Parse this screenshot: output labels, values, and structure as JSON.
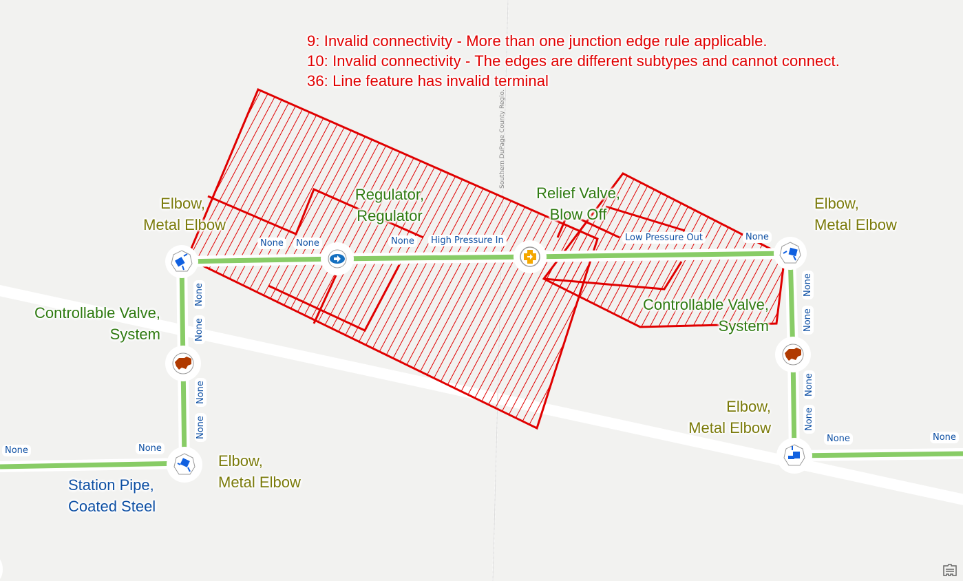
{
  "errors": [
    "9: Invalid connectivity - More than one junction edge rule applicable.",
    "10: Invalid connectivity - The edges are different subtypes and cannot connect.",
    "36: Line feature has invalid terminal"
  ],
  "road_label": "Southern DuPage County Regio.",
  "assets": {
    "elbow_top_left": [
      "Elbow,",
      "Metal Elbow"
    ],
    "regulator": [
      "Regulator,",
      "Regulator"
    ],
    "relief_valve": [
      "Relief Valve,",
      "Blow Off"
    ],
    "elbow_top_right": [
      "Elbow,",
      "Metal Elbow"
    ],
    "controllable_valve_left": [
      "Controllable Valve,",
      "System"
    ],
    "controllable_valve_right": [
      "Controllable Valve,",
      "System"
    ],
    "elbow_bottom_left": [
      "Elbow,",
      "Metal Elbow"
    ],
    "elbow_bottom_right": [
      "Elbow,",
      "Metal Elbow"
    ],
    "station_pipe": [
      "Station Pipe,",
      "Coated Steel"
    ]
  },
  "terminals": {
    "t1": "None",
    "t2": "None",
    "t3": "None",
    "t4": "High Pressure In",
    "t5": "Low Pressure Out",
    "t6": "None",
    "left_v1": "None",
    "left_v2": "None",
    "left_v3": "None",
    "left_v4": "None",
    "right_v1": "None",
    "right_v2": "None",
    "right_v3": "None",
    "right_v4": "None",
    "bottom_left_1": "None",
    "bottom_left_2": "None",
    "bottom_right_1": "None",
    "bottom_right_2": "None"
  },
  "colors": {
    "error": "#e00000",
    "pipe": "#88cc66",
    "asset_green": "#2e7a10",
    "asset_olive": "#7a7a0a",
    "asset_blue": "#0d4fa3",
    "elbow_icon": "#1060e0",
    "valve_icon": "#b03a00",
    "regulator_icon": "#1570c0",
    "relief_icon": "#f5a800"
  },
  "controls": {
    "basemap_icon": "basemap-gallery-icon"
  }
}
